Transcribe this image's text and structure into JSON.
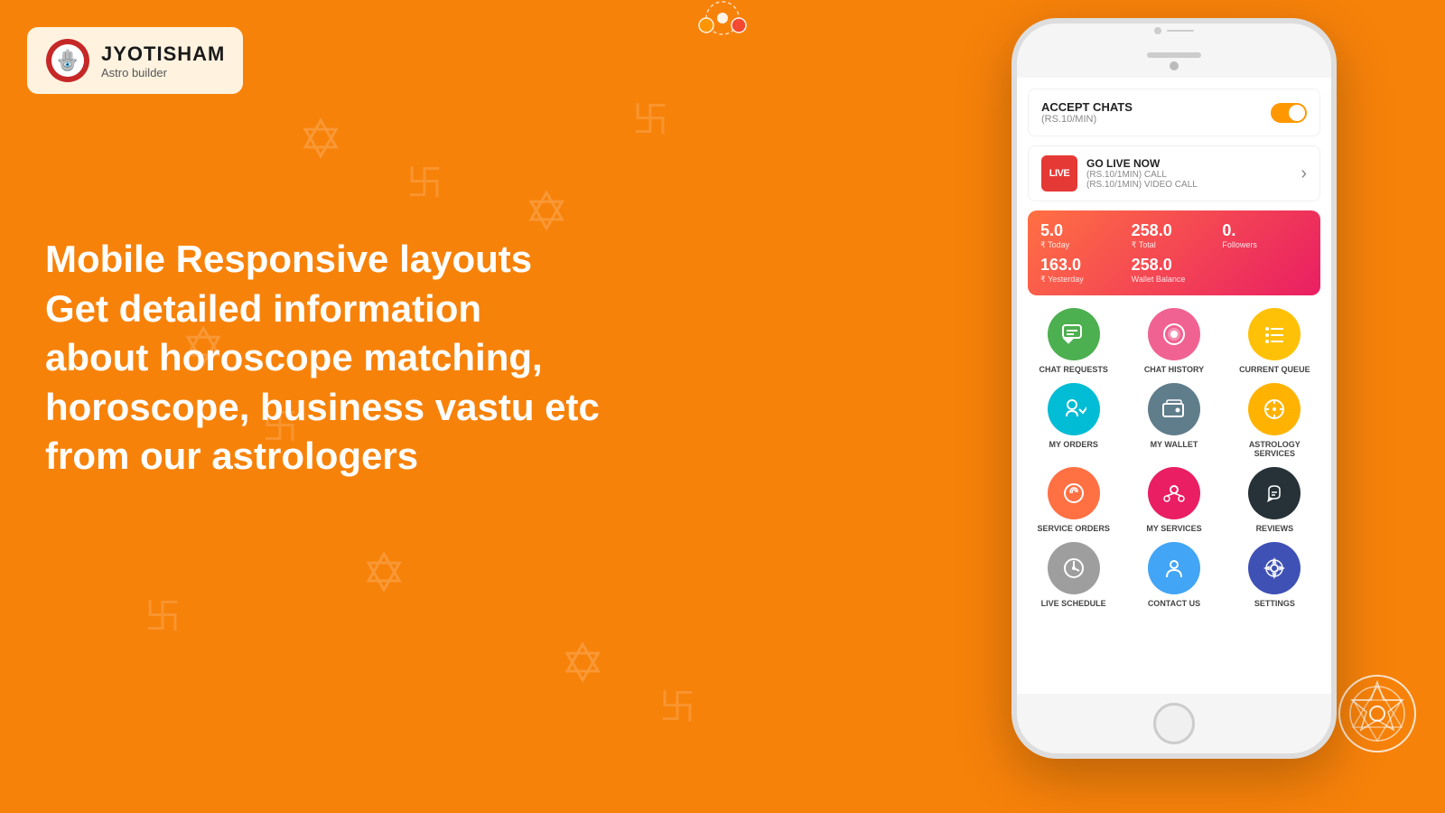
{
  "logo": {
    "title": "JYOTISHAM",
    "subtitle": "Astro builder"
  },
  "hero": {
    "line1": "Mobile Responsive layouts",
    "line2": "Get detailed information",
    "line3": "about horoscope matching,",
    "line4": "horoscope, business vastu etc",
    "line5": "from our astrologers"
  },
  "phone": {
    "accept_chats": {
      "title": "ACCEPT CHATS",
      "subtitle": "(RS.10/MIN)"
    },
    "go_live": {
      "title": "GO LIVE NOW",
      "line1": "(RS.10/1MIN) CALL",
      "line2": "(RS.10/1MIN) VIDEO CALL",
      "badge": "LIVE"
    },
    "stats": {
      "today_value": "5.0",
      "today_label": "₹ Today",
      "total_value": "258.0",
      "total_label": "₹ Total",
      "followers_value": "0.",
      "followers_label": "Followers",
      "yesterday_value": "163.0",
      "yesterday_label": "₹ Yesterday",
      "wallet_value": "258.0",
      "wallet_label": "Wallet Balance"
    },
    "menu": [
      {
        "label": "CHAT REQUESTS",
        "icon": "💬",
        "color": "c-green"
      },
      {
        "label": "CHAT HISTORY",
        "icon": "🗨",
        "color": "c-pink"
      },
      {
        "label": "CURRENT QUEUE",
        "icon": "📋",
        "color": "c-yellow"
      },
      {
        "label": "MY ORDERS",
        "icon": "📦",
        "color": "c-cyan"
      },
      {
        "label": "MY WALLET",
        "icon": "👛",
        "color": "c-gray"
      },
      {
        "label": "ASTROLOGY SERVICES",
        "icon": "⚙",
        "color": "c-gold"
      },
      {
        "label": "SERVICE ORDERS",
        "icon": "🔧",
        "color": "c-orange"
      },
      {
        "label": "MY SERVICES",
        "icon": "✨",
        "color": "c-red-pink"
      },
      {
        "label": "REVIEWS",
        "icon": "👍",
        "color": "c-dark"
      },
      {
        "label": "LIVE SCHEDULE",
        "icon": "⏱",
        "color": "c-teal"
      },
      {
        "label": "CONTACT US",
        "icon": "👤",
        "color": "c-blue-gray"
      },
      {
        "label": "SETTINGS",
        "icon": "⚙",
        "color": "c-blue"
      }
    ]
  },
  "colors": {
    "background": "#F7820A",
    "phone_bg": "#f5f5f5"
  }
}
